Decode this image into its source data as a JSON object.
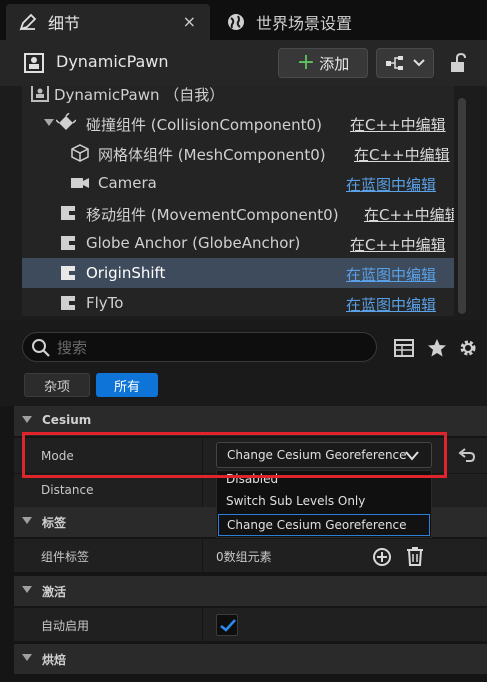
{
  "tabs": [
    {
      "label": "细节",
      "close": "×"
    },
    {
      "label": "世界场景设置"
    }
  ],
  "header": {
    "actor_name": "DynamicPawn",
    "add_label": "添加"
  },
  "tree": [
    {
      "name": "DynamicPawn （自我）",
      "link": "",
      "link_type": ""
    },
    {
      "name": "碰撞组件 (CollisionComponent0)",
      "link": "在C++中编辑",
      "link_type": "cpp"
    },
    {
      "name": "网格体组件 (MeshComponent0)",
      "link": "在C++中编辑",
      "link_type": "cpp"
    },
    {
      "name": "Camera",
      "link": "在蓝图中编辑",
      "link_type": "bp"
    },
    {
      "name": "移动组件 (MovementComponent0)",
      "link": "在C++中编辑",
      "link_type": "cpp"
    },
    {
      "name": "Globe Anchor (GlobeAnchor)",
      "link": "在C++中编辑",
      "link_type": "cpp"
    },
    {
      "name": "OriginShift",
      "link": "在蓝图中编辑",
      "link_type": "bp"
    },
    {
      "name": "FlyTo",
      "link": "在蓝图中编辑",
      "link_type": "bp"
    }
  ],
  "search": {
    "placeholder": "搜索"
  },
  "filters": {
    "misc": "杂项",
    "all": "所有"
  },
  "categories": {
    "cesium": "Cesium",
    "tags": "标签",
    "activation": "激活",
    "bake": "烘焙"
  },
  "properties": {
    "mode_label": "Mode",
    "mode_value": "Change Cesium Georeference",
    "distance_label": "Distance",
    "component_tags_label": "组件标签",
    "component_tags_value": "0数组元素",
    "auto_activate_label": "自动启用",
    "auto_activate_checked": true
  },
  "dropdown_options": [
    "Disabled",
    "Switch Sub Levels Only",
    "Change Cesium Georeference"
  ],
  "colors": {
    "accent_blue": "#0e74d8",
    "link_blue": "#5aa0e6",
    "highlight_red": "#e0242b",
    "add_green": "#5ec45e"
  }
}
